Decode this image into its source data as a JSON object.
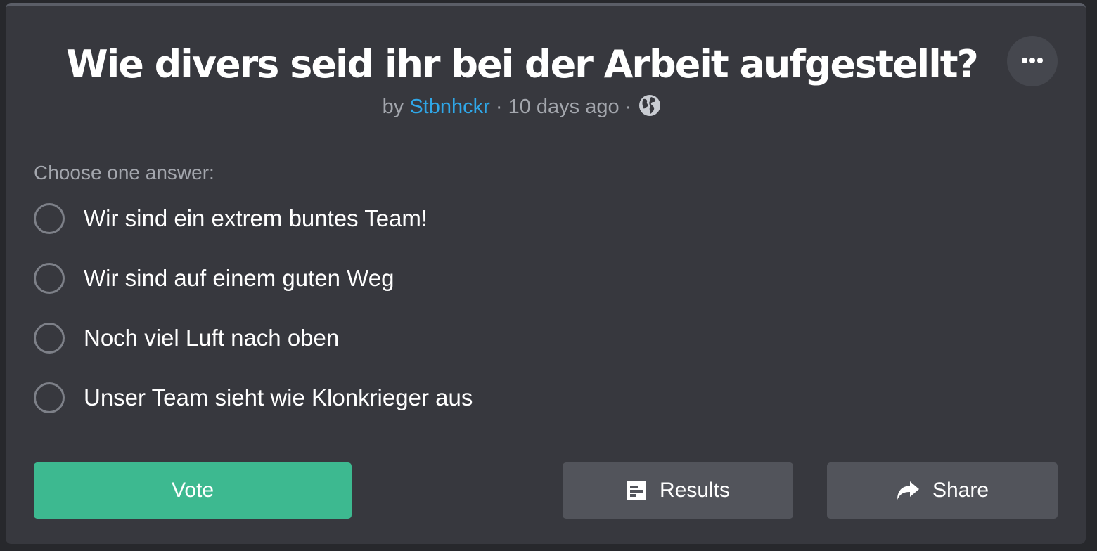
{
  "poll": {
    "title": "Wie divers seid ihr bei der Arbeit aufgestellt?",
    "meta": {
      "by": "by",
      "author": "Stbnhckr",
      "separator": "·",
      "time": "10 days ago",
      "visibility_icon": "globe-icon"
    },
    "menu_icon": "more-horizontal-icon",
    "instruction": "Choose one answer:",
    "options": [
      {
        "label": "Wir sind ein extrem buntes Team!",
        "selected": false
      },
      {
        "label": "Wir sind auf einem guten Weg",
        "selected": false
      },
      {
        "label": "Noch viel Luft nach oben",
        "selected": false
      },
      {
        "label": "Unser Team sieht wie Klonkrieger aus",
        "selected": false
      }
    ]
  },
  "actions": {
    "vote_label": "Vote",
    "results_label": "Results",
    "results_icon": "poll-results-icon",
    "share_label": "Share",
    "share_icon": "share-arrow-icon"
  },
  "colors": {
    "background": "#37383e",
    "accent": "#3db990",
    "link": "#2fa7e8",
    "secondary_button": "#52545b"
  }
}
